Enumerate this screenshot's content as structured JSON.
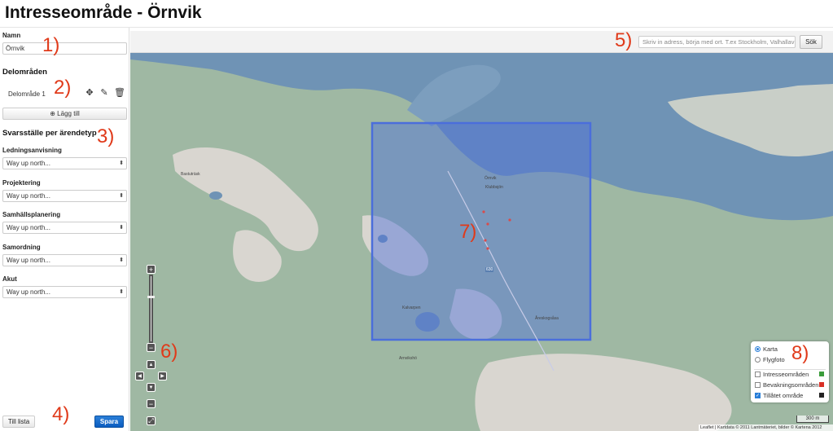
{
  "page": {
    "title": "Intresseområde - Örnvik"
  },
  "form": {
    "name_label": "Namn",
    "name_value": "Örnvik",
    "subareas_title": "Delområden",
    "subarea_name": "Delområde 1",
    "add_label": "Lägg till",
    "response_title": "Svarsställe per ärendetyp",
    "fields": [
      {
        "label": "Ledningsanvisning",
        "value": "Way up north..."
      },
      {
        "label": "Projektering",
        "value": "Way up north..."
      },
      {
        "label": "Samhällsplanering",
        "value": "Way up north..."
      },
      {
        "label": "Samordning",
        "value": "Way up north..."
      },
      {
        "label": "Akut",
        "value": "Way up north..."
      }
    ],
    "list_button": "Till lista",
    "save_button": "Spara"
  },
  "search": {
    "placeholder": "Skriv in adress, börja med ort. T.ex Stockholm, Valhallav",
    "button": "Sök"
  },
  "layers": {
    "base": [
      {
        "label": "Karta",
        "selected": true
      },
      {
        "label": "Flygfoto",
        "selected": false
      }
    ],
    "overlays": [
      {
        "label": "Intresseområden",
        "checked": false,
        "color": "#3a9c3a"
      },
      {
        "label": "Bevakningsområden",
        "checked": false,
        "color": "#d93025"
      },
      {
        "label": "Tillåtet område",
        "checked": true,
        "color": "#222222"
      }
    ]
  },
  "map": {
    "scale_label": "300 m",
    "attribution": "Leaflet | Kartdata © 2011 Lantmäteriet, bilder © Kartena 2012",
    "place_labels": [
      "Örnvik",
      "Klubbsjön",
      "Åreskogsåsa",
      "Bastuträsk",
      "Arnvikshö",
      "Kalvarpen",
      "630"
    ],
    "water_color": "#6f93b5",
    "land_color": "#9fb8a3",
    "selection_color": "#4b6edb"
  },
  "annotations": [
    "1)",
    "2)",
    "3)",
    "4)",
    "5)",
    "6)",
    "7)",
    "8)"
  ]
}
